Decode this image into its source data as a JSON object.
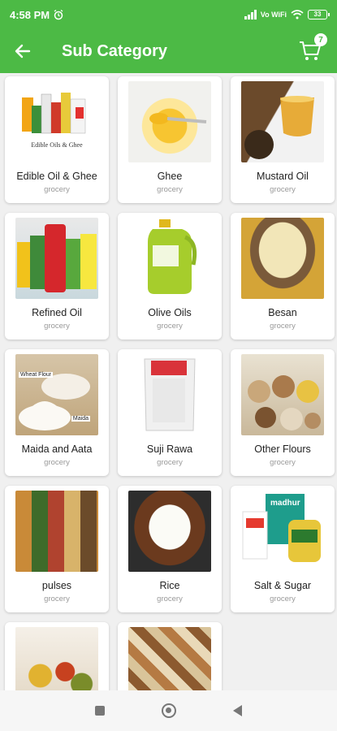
{
  "status_bar": {
    "time": "4:58 PM",
    "network": "Vo WiFi",
    "battery": "33"
  },
  "app_bar": {
    "title": "Sub Category",
    "cart_count": "7"
  },
  "categories": [
    {
      "name": "Edible Oil & Ghee",
      "category": "grocery",
      "image_caption": "Edible Oils & Ghee",
      "icon": "edible-oil-image"
    },
    {
      "name": "Ghee",
      "category": "grocery",
      "icon": "ghee-image"
    },
    {
      "name": "Mustard Oil",
      "category": "grocery",
      "icon": "mustard-oil-image"
    },
    {
      "name": "Refined Oil",
      "category": "grocery",
      "icon": "refined-oil-image"
    },
    {
      "name": "Olive Oils",
      "category": "grocery",
      "icon": "olive-oil-image"
    },
    {
      "name": "Besan",
      "category": "grocery",
      "icon": "besan-image"
    },
    {
      "name": "Maida and Aata",
      "category": "grocery",
      "image_caption": "Wheat Flour",
      "image_caption_2": "Maida",
      "icon": "maida-image"
    },
    {
      "name": "Suji Rawa",
      "category": "grocery",
      "icon": "suji-image"
    },
    {
      "name": "Other Flours",
      "category": "grocery",
      "icon": "flours-image"
    },
    {
      "name": "pulses",
      "category": "grocery",
      "icon": "pulses-image"
    },
    {
      "name": "Rice",
      "category": "grocery",
      "icon": "rice-image"
    },
    {
      "name": "Salt & Sugar",
      "category": "grocery",
      "image_caption": "madhur",
      "icon": "salt-sugar-image"
    },
    {
      "name": "",
      "category": "",
      "icon": "spices-image"
    },
    {
      "name": "",
      "category": "",
      "icon": "dry-fruits-image"
    }
  ],
  "colors": {
    "primary": "#4cba45",
    "card": "#ffffff",
    "text": "#222222",
    "subtext": "#999999"
  }
}
